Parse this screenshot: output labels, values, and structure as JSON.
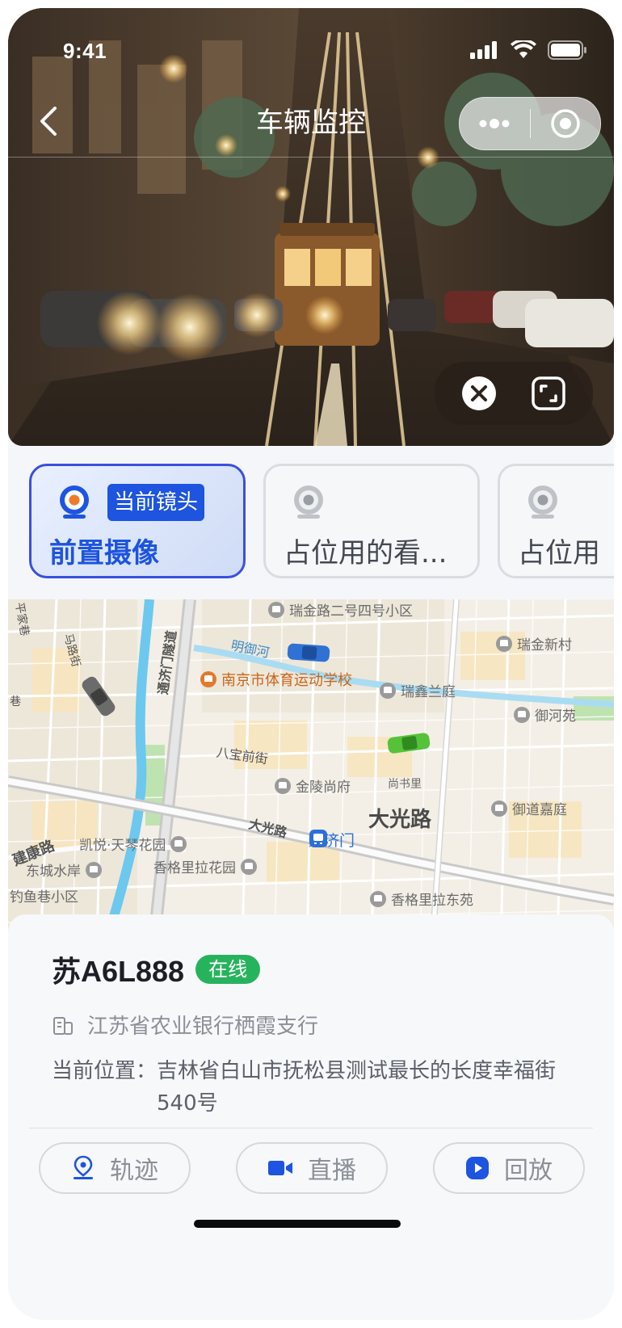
{
  "status_bar": {
    "time": "9:41"
  },
  "nav": {
    "title": "车辆监控",
    "back_icon": "chevron-left-icon",
    "more_icon": "more-dots-icon",
    "target_icon": "target-circle-icon"
  },
  "video_controls": {
    "close_icon": "close-circle-icon",
    "fullscreen_icon": "fullscreen-icon"
  },
  "cameras": [
    {
      "label": "前置摄像",
      "badge": "当前镜头",
      "active": true
    },
    {
      "label": "占位用的看...",
      "badge": "",
      "active": false
    },
    {
      "label": "占位用",
      "badge": "",
      "active": false
    }
  ],
  "map": {
    "pois": [
      {
        "name": "瑞金路二号四号小区"
      },
      {
        "name": "瑞金新村"
      },
      {
        "name": "南京市体育运动学校"
      },
      {
        "name": "瑞鑫兰庭"
      },
      {
        "name": "御河苑"
      },
      {
        "name": "金陵尚府"
      },
      {
        "name": "尚书里"
      },
      {
        "name": "大光路"
      },
      {
        "name": "御道嘉庭"
      },
      {
        "name": "凯悦·天琴花园"
      },
      {
        "name": "香格里拉花园"
      },
      {
        "name": "东城水岸"
      },
      {
        "name": "通济门"
      },
      {
        "name": "钓鱼巷小区"
      },
      {
        "name": "香格里拉东苑"
      }
    ],
    "roads": [
      {
        "name": "明御河"
      },
      {
        "name": "通济门隧道"
      },
      {
        "name": "八宝前街"
      },
      {
        "name": "大光路"
      },
      {
        "name": "建康路"
      },
      {
        "name": "马路街"
      },
      {
        "name": "平家巷"
      },
      {
        "name": "巷"
      }
    ]
  },
  "vehicle": {
    "plate": "苏A6L888",
    "status": "在线",
    "org": "江苏省农业银行栖霞支行",
    "location_label": "当前位置：",
    "location_value": "吉林省白山市抚松县测试最长的长度幸福街540号"
  },
  "actions": [
    {
      "label": "轨迹",
      "icon": "track-pin-icon"
    },
    {
      "label": "直播",
      "icon": "video-camera-icon"
    },
    {
      "label": "回放",
      "icon": "play-circle-icon"
    }
  ],
  "colors": {
    "accent": "#1d54e0",
    "online": "#27b35d",
    "active_border": "#3a4fe0"
  }
}
